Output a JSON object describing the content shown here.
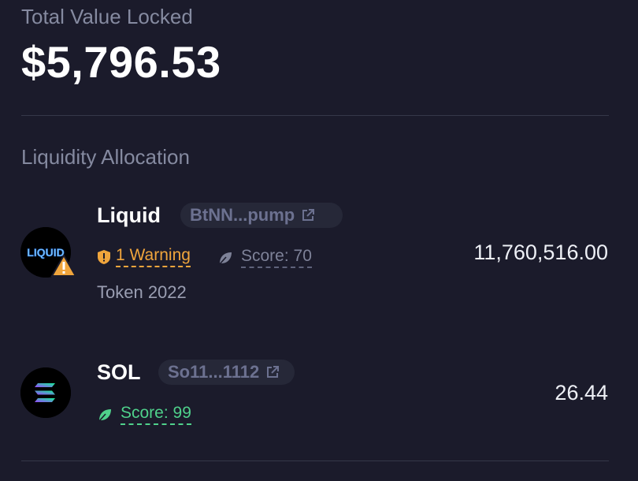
{
  "tvl": {
    "label": "Total Value Locked",
    "value": "$5,796.53"
  },
  "allocation": {
    "label": "Liquidity Allocation",
    "tokens": [
      {
        "name": "Liquid",
        "address": "BtNN...pump",
        "logo_text": "LIQUID",
        "warning": "1 Warning",
        "score": "Score: 70",
        "program": "Token 2022",
        "amount": "11,760,516.00",
        "icon": "liquid-logo-icon"
      },
      {
        "name": "SOL",
        "address": "So11...1112",
        "score": "Score: 99",
        "amount": "26.44",
        "icon": "solana-logo-icon"
      }
    ]
  },
  "colors": {
    "background": "#1b1b2b",
    "warning": "#f0a53c",
    "good": "#4fd18b",
    "muted": "#858aa0"
  }
}
